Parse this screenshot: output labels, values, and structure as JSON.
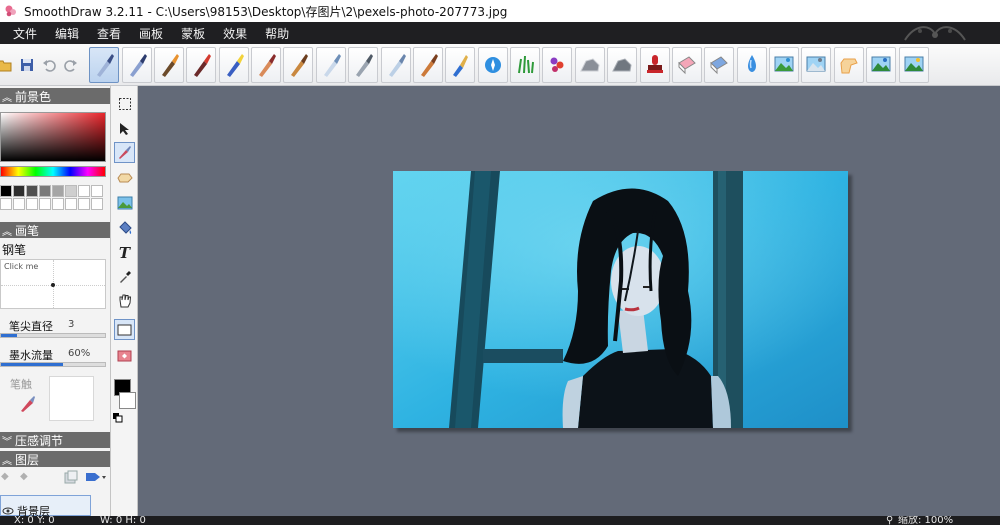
{
  "window": {
    "title": "SmoothDraw 3.2.11 - C:\\Users\\98153\\Desktop\\存图片\\2\\pexels-photo-207773.jpg"
  },
  "menu": {
    "items": [
      "文件",
      "编辑",
      "查看",
      "画板",
      "蒙板",
      "效果",
      "帮助"
    ]
  },
  "toolbar": {
    "brushes": [
      "pen-brush",
      "calligraphy-pen-brush",
      "pencil-brush",
      "red-pencil-brush",
      "crayon-brush",
      "marker-brush",
      "oil-brush",
      "airbrush-brush",
      "spray-dots-brush",
      "spray-fan-brush",
      "flat-brush",
      "paint-bucket-brush",
      "blur-brush",
      "grass-brush",
      "flower-brush",
      "texture-brush",
      "rock-brush",
      "stamp-brush",
      "pink-eraser-brush",
      "blue-eraser-brush",
      "water-drop-brush",
      "landscape-brush",
      "mountain-brush",
      "smudge-hand-brush",
      "scene-brush",
      "sunny-scene-brush"
    ]
  },
  "colors": {
    "bg": "#636a78",
    "panel": "#f3f3f3",
    "header": "#6b6b6b",
    "menubar": "#1f1f22",
    "accent": "#2f6fd1"
  },
  "panel": {
    "foreground_header": "前景色",
    "brush_header": "画笔",
    "brush_name": "钢笔",
    "click_me": "Click me",
    "tip_size_label": "笔尖直径",
    "tip_size_value": "3",
    "tip_size_level": 0.15,
    "ink_flow_label": "墨水流量",
    "ink_flow_value": "60%",
    "ink_flow_level": 0.6,
    "brush_tip_label": "笔触",
    "pressure_header": "压感调节",
    "layers_header": "图层",
    "layer_name": "背景层"
  },
  "status": {
    "position": "X: 0 Y: 0",
    "size": "W: 0 H: 0",
    "zoom": "缩放: 100%"
  }
}
